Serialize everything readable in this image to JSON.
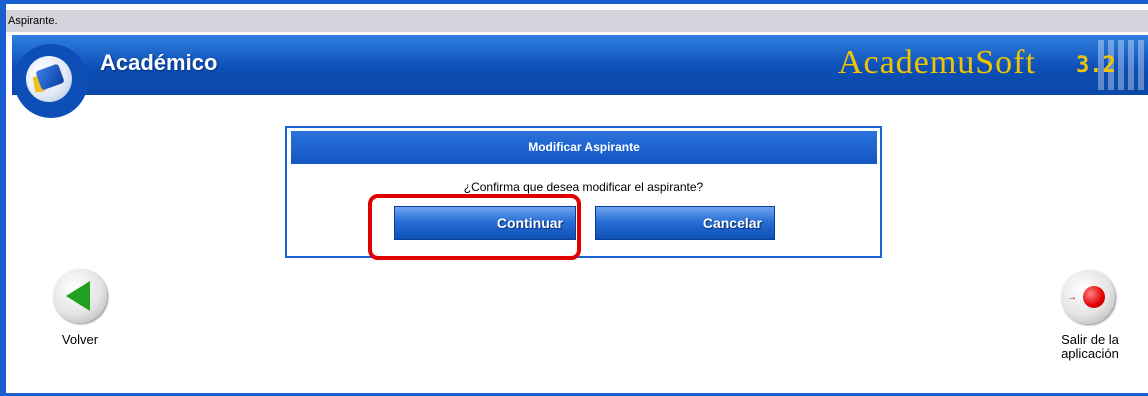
{
  "window": {
    "title": "Aspirante."
  },
  "header": {
    "app_title": "Académico",
    "brand_name": "AcademuSoft",
    "brand_version": "3.2"
  },
  "dialog": {
    "title": "Modificar Aspirante",
    "question": "¿Confirma que desea modificar el aspirante?",
    "continue_label": "Continuar",
    "cancel_label": "Cancelar"
  },
  "nav": {
    "back_label": "Volver",
    "exit_label": "Salir de la aplicación"
  },
  "colors": {
    "header_blue": "#0d4fb6",
    "brand_gold": "#f2c400",
    "highlight_red": "#e00000",
    "back_green": "#1ea21e"
  }
}
